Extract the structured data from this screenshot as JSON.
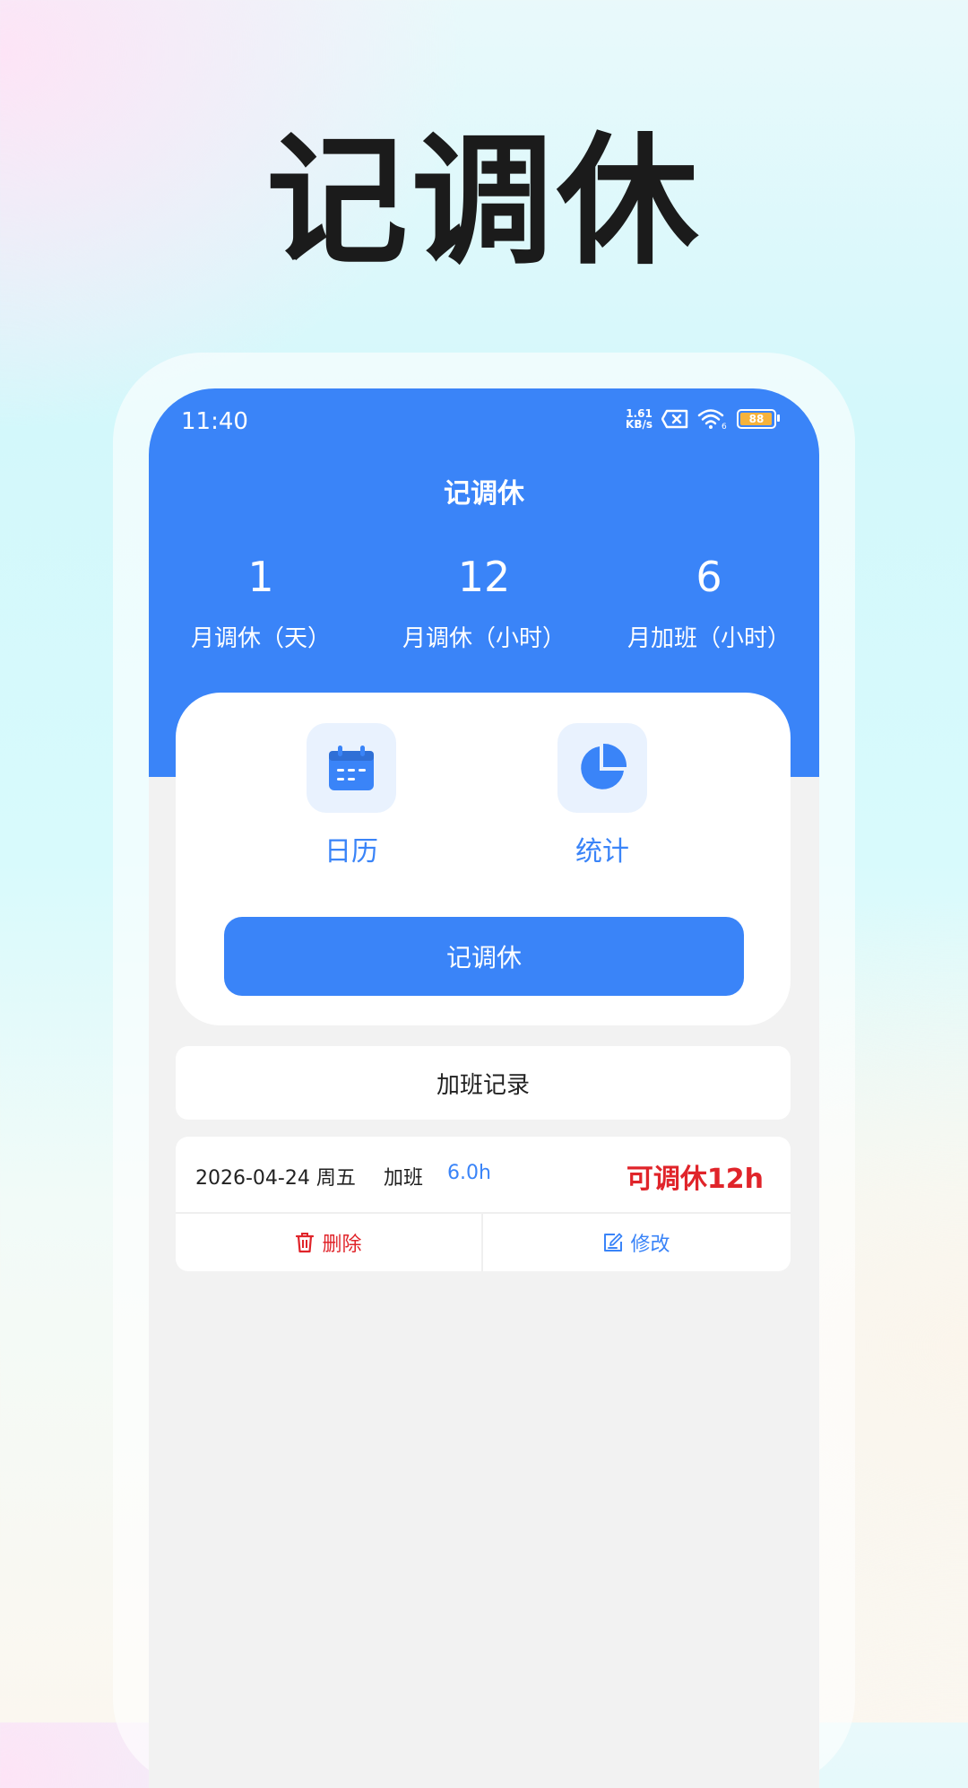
{
  "headline": "记调休",
  "status_bar": {
    "time": "11:40",
    "speed_value": "1.61",
    "speed_unit": "KB/s",
    "battery": "88"
  },
  "app": {
    "title": "记调休",
    "stats": [
      {
        "value": "1",
        "label": "月调休（天）"
      },
      {
        "value": "12",
        "label": "月调休（小时）"
      },
      {
        "value": "6",
        "label": "月加班（小时）"
      }
    ],
    "shortcuts": [
      {
        "label": "日历",
        "icon": "calendar-icon"
      },
      {
        "label": "统计",
        "icon": "pie-chart-icon"
      }
    ],
    "primary_button": "记调休",
    "section_title": "加班记录",
    "records": [
      {
        "date": "2026-04-24 周五",
        "type": "加班",
        "hours": "6.0h",
        "rest": "可调休12h",
        "delete_label": "删除",
        "edit_label": "修改"
      }
    ]
  },
  "colors": {
    "primary": "#3a84f8",
    "danger": "#e0242a",
    "background": "#f2f2f2"
  }
}
